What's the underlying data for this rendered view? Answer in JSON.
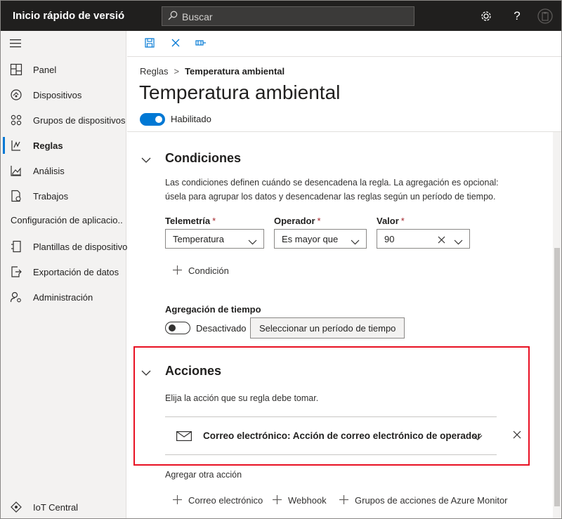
{
  "app": {
    "title": "Inicio rápido de versión...",
    "search_placeholder": "Buscar"
  },
  "topbar_icons": [
    "gear-icon",
    "help-icon",
    "clipboard-icon"
  ],
  "sidebar": {
    "items": [
      {
        "label": "Panel",
        "icon": "dashboard-icon",
        "active": false
      },
      {
        "label": "Dispositivos",
        "icon": "devices-icon",
        "active": false
      },
      {
        "label": "Grupos de dispositivos",
        "icon": "device-groups-icon",
        "active": false
      },
      {
        "label": "Reglas",
        "icon": "rules-icon",
        "active": true
      },
      {
        "label": "Análisis",
        "icon": "analytics-icon",
        "active": false
      },
      {
        "label": "Trabajos",
        "icon": "jobs-icon",
        "active": false
      }
    ],
    "section_label": "Configuración de aplicacio...",
    "config_items": [
      {
        "label": "Plantillas de dispositivo",
        "icon": "device-templates-icon"
      },
      {
        "label": "Exportación de datos",
        "icon": "data-export-icon"
      },
      {
        "label": "Administración",
        "icon": "admin-icon"
      }
    ],
    "footer": {
      "label": "IoT Central",
      "icon": "iot-central-icon"
    }
  },
  "toolbar": {
    "buttons": [
      "save-icon",
      "discard-icon",
      "test-icon"
    ]
  },
  "breadcrumb": {
    "parent": "Reglas",
    "current": "Temperatura ambiental"
  },
  "page_title": "Temperatura ambiental",
  "enabled_toggle": {
    "label": "Habilitado",
    "on": true
  },
  "conditions": {
    "title": "Condiciones",
    "description_line1": "Las condiciones definen cuándo se desencadena la regla. La agregación es opcional:",
    "description_line2": "úsela para agrupar los datos y desencadenar las reglas según un período de tiempo.",
    "telemetry": {
      "label": "Telemetría",
      "required": "*",
      "value": "Temperatura"
    },
    "operator": {
      "label": "Operador",
      "required": "*",
      "value": "Es mayor que"
    },
    "value": {
      "label": "Valor",
      "required": "*",
      "value": "90"
    },
    "add_condition": "Condición",
    "time_aggregation": {
      "label": "Agregación de tiempo",
      "toggle_label": "Desactivado",
      "on": false,
      "button": "Seleccionar un período de tiempo"
    }
  },
  "actions": {
    "title": "Acciones",
    "description": "Elija la acción que su regla debe tomar.",
    "action_item": "Correo electrónico: Acción de correo electrónico de operador",
    "add_another": "Agregar otra acción",
    "add_buttons": {
      "email": "Correo electrónico",
      "webhook": "Webhook",
      "azure_monitor": "Grupos de acciones de Azure Monitor"
    }
  },
  "colors": {
    "topbar": "#201f1e",
    "accent": "#0078d4",
    "highlight": "#e81123",
    "sidebar": "#f3f2f1"
  }
}
